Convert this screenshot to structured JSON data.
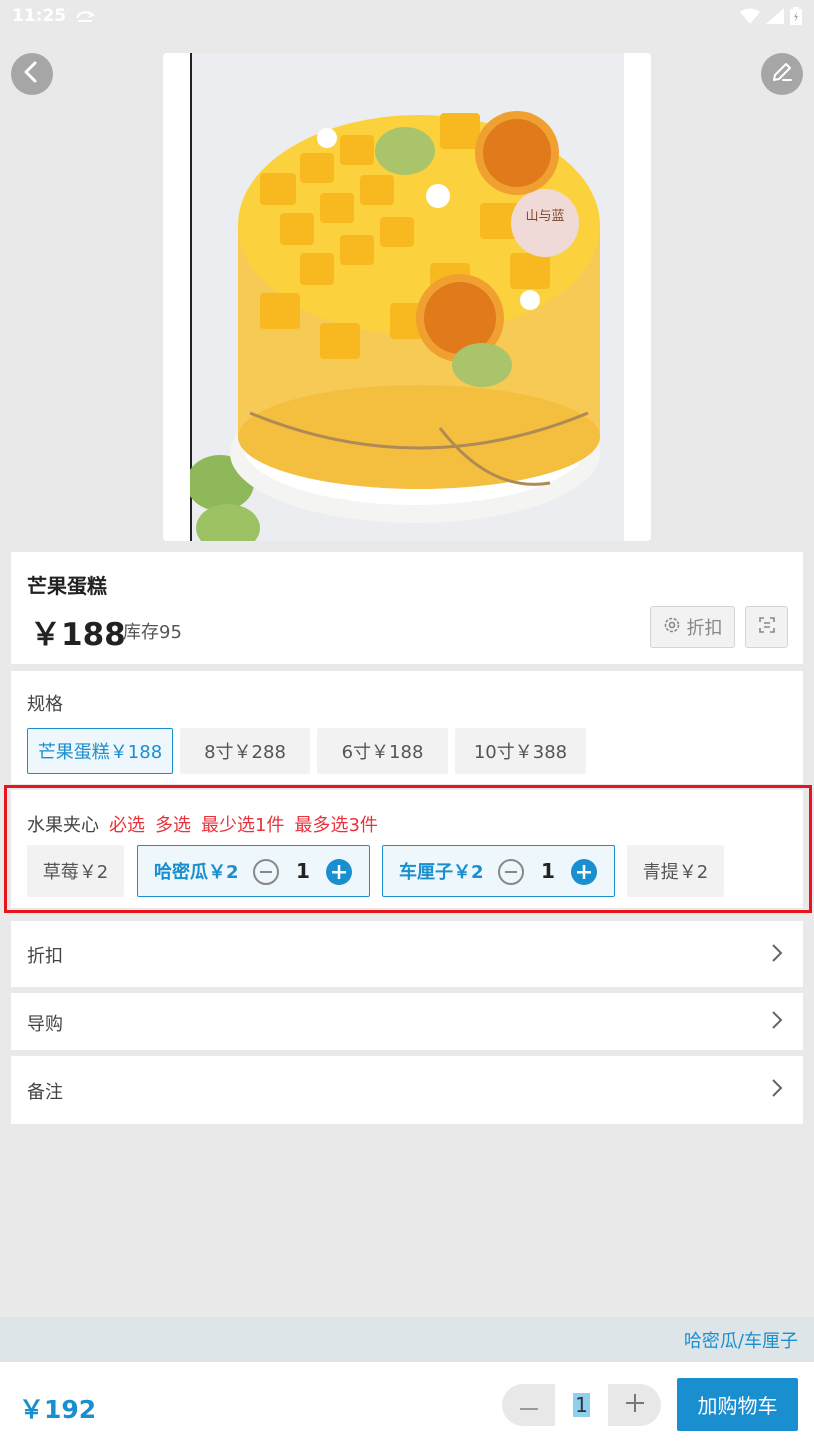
{
  "status_bar": {
    "time": "11:25"
  },
  "product": {
    "name": "芒果蛋糕",
    "price": "￥188",
    "stock": "库存95",
    "discount_button": "折扣",
    "image_logo": "山与蓝"
  },
  "spec": {
    "label": "规格",
    "options": [
      "芒果蛋糕￥188",
      "8寸￥288",
      "6寸￥188",
      "10寸￥388"
    ],
    "selected_index": 0
  },
  "fruit": {
    "label": "水果夹心",
    "tags": [
      "必选",
      "多选",
      "最少选1件",
      "最多选3件"
    ],
    "options": [
      {
        "name": "草莓￥2",
        "selected": false
      },
      {
        "name": "哈密瓜￥2",
        "selected": true,
        "qty": "1"
      },
      {
        "name": "车厘子￥2",
        "selected": true,
        "qty": "1"
      },
      {
        "name": "青提￥2",
        "selected": false
      }
    ]
  },
  "rows": {
    "discount": "折扣",
    "guide": "导购",
    "remark": "备注"
  },
  "selection_summary": "哈密瓜/车厘子",
  "bottom": {
    "total": "￥192",
    "quantity": "1",
    "add_to_cart": "加购物车"
  },
  "colors": {
    "accent": "#1a8fd0",
    "required": "#e8323c",
    "highlight": "#e8131d"
  }
}
